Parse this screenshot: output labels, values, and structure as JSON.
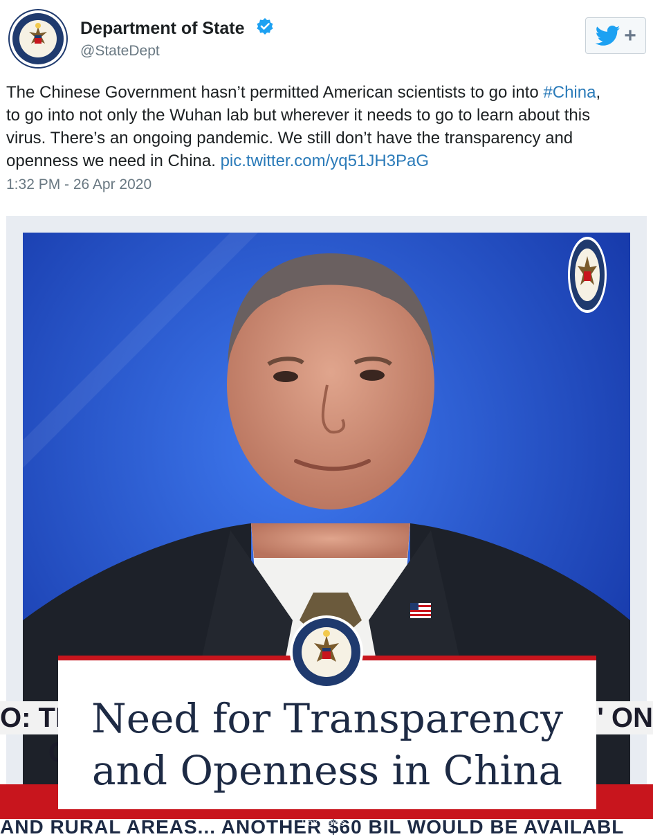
{
  "account": {
    "name": "Department of State",
    "handle": "@StateDept",
    "verified": true,
    "seal_lettering": "DEPARTMENT OF STATE · UNITED STATES OF AMERICA"
  },
  "follow_button": {
    "icon": "twitter-bird-icon",
    "plus": "+"
  },
  "tweet": {
    "text_part1": "The Chinese Government hasn’t permitted American scientists to go into ",
    "hashtag": "#China",
    "text_part2": ",\nto go into not only the Wuhan lab but wherever it needs to go to learn about this\nvirus. There’s an ongoing pandemic. We still don’t have the transparency and\nopenness we need in China. ",
    "pic_link": "pic.twitter.com/yq51JH3PaG",
    "timestamp": "1:32 PM - 26 Apr 2020"
  },
  "media": {
    "card_line1": "Need for Transparency",
    "card_line2": "and Openness in China",
    "ticker_left": "O: TI",
    "ticker_left2": "C",
    "ticker_right": "' ON",
    "crawl": "AND RURAL AREAS...   ANOTHER $60 BIL WOULD BE AVAILABL",
    "watermark": "Fox News"
  },
  "colors": {
    "link": "#2b7bb9",
    "muted": "#697882",
    "verified": "#1da1f2",
    "twitter_blue": "#1da1f2",
    "navy": "#1d2a44",
    "news_red": "#c8151d",
    "background_blue": "#2d63e6"
  }
}
